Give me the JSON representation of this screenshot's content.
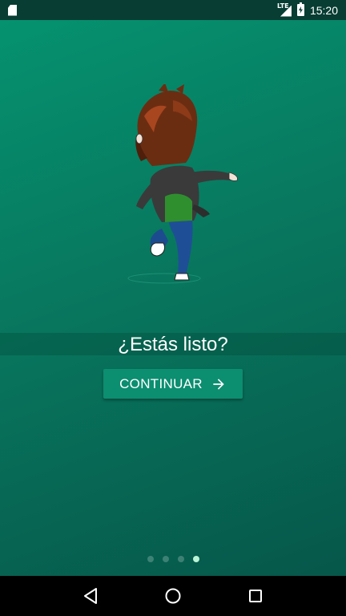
{
  "status_bar": {
    "network_label": "LTE",
    "time": "15:20",
    "icons": [
      "sd-card-icon",
      "signal-icon",
      "battery-charging-icon"
    ]
  },
  "onboarding": {
    "caption": "¿Estás listo?",
    "continue_label": "CONTINUAR",
    "page_count": 4,
    "current_page": 4
  },
  "colors": {
    "background": "#08775e",
    "status_bar": "#073d33",
    "button": "#0c8e70",
    "active_dot": "#b9f4d6",
    "nav_bar": "#000000"
  },
  "nav_bar": {
    "icons": [
      "back-icon",
      "home-icon",
      "recents-icon"
    ]
  }
}
